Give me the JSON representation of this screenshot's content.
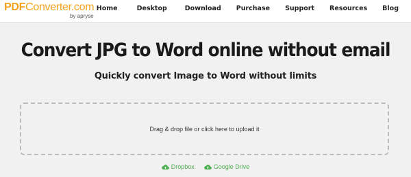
{
  "header": {
    "logo": {
      "pdf": "PDF",
      "converter": "Converter.com",
      "by": "by apryse"
    },
    "nav": [
      "Home",
      "Desktop",
      "Download",
      "Purchase",
      "Support",
      "Resources",
      "Blog"
    ]
  },
  "main": {
    "title": "Convert JPG to Word online without email",
    "subtitle": "Quickly convert Image to Word without limits",
    "dropzone_text": "Drag & drop file or click here to upload it",
    "cloud_links": {
      "dropbox": "Dropbox",
      "google_drive": "Google Drive"
    }
  },
  "colors": {
    "brand": "#f2a21b",
    "link_green": "#4caf50",
    "background": "#f1f1f1"
  },
  "icons": {
    "cloud_upload": "cloud-upload-icon"
  }
}
